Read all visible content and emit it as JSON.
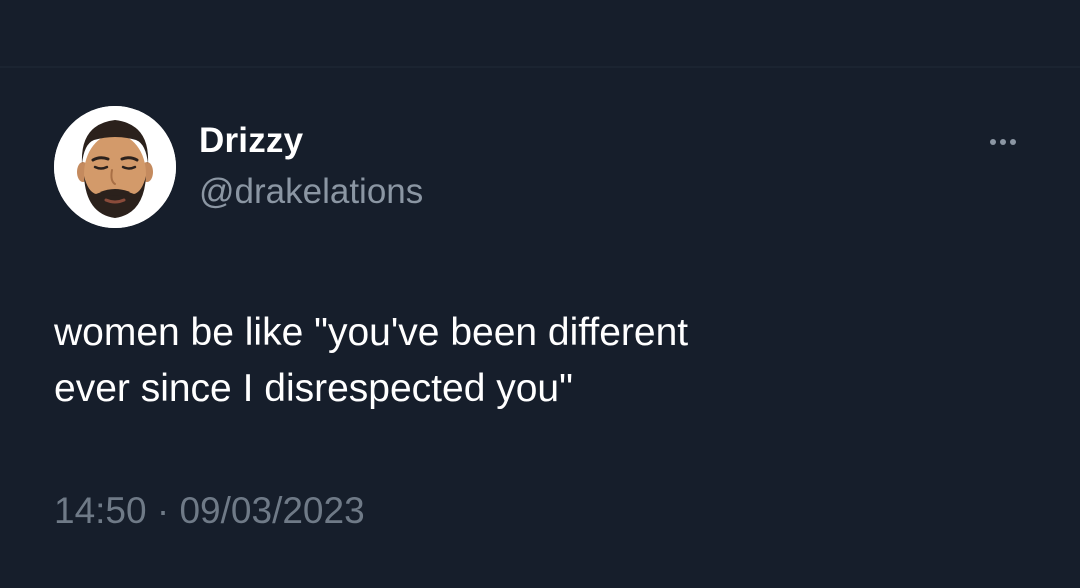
{
  "tweet": {
    "display_name": "Drizzy",
    "handle": "@drakelations",
    "text_lines": [
      "women be like \"you've been different",
      "ever since I disrespected you\""
    ],
    "time": "14:50",
    "separator": "·",
    "date": "09/03/2023",
    "more_icon": "more-horizontal-icon",
    "avatar_icon": "cartoon-face-avatar"
  },
  "colors": {
    "background": "#161e2b",
    "primary_text": "#ffffff",
    "secondary_text": "#8b96a3",
    "timestamp_text": "#6f7a87",
    "avatar_bg": "#ffffff"
  }
}
